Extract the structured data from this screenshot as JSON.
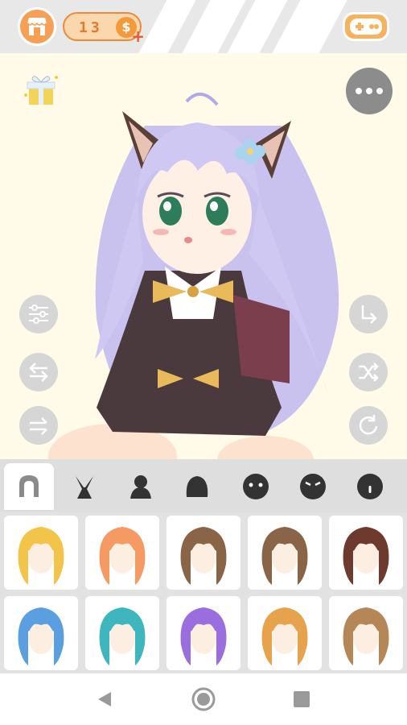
{
  "topbar": {
    "coins": "13",
    "coin_symbol": "$",
    "coin_plus": "+",
    "shop_icon": "shop-icon",
    "game_icon": "gamepad-icon"
  },
  "canvas": {
    "character": "anime-girl-character",
    "gift_icon": "gift-icon",
    "more_icon": "more-dots-icon",
    "left_tools": [
      "adjust-sliders-icon",
      "swap-arrows-icon",
      "flip-arrows-icon"
    ],
    "right_tools": [
      "export-icon",
      "shuffle-icon",
      "redo-icon"
    ]
  },
  "tabs": [
    {
      "name": "hair",
      "icon": "hair-icon",
      "active": true
    },
    {
      "name": "ears",
      "icon": "bunny-ears-icon",
      "active": false
    },
    {
      "name": "body",
      "icon": "body-silhouette-icon",
      "active": false
    },
    {
      "name": "head",
      "icon": "head-shape-icon",
      "active": false
    },
    {
      "name": "eyes",
      "icon": "eyes-face-icon",
      "active": false
    },
    {
      "name": "brows",
      "icon": "angry-face-icon",
      "active": false
    },
    {
      "name": "mouth",
      "icon": "mouth-face-icon",
      "active": false
    }
  ],
  "hair_items": [
    {
      "color": "#f3c44a"
    },
    {
      "color": "#f59a62"
    },
    {
      "color": "#8a6446"
    },
    {
      "color": "#8a6446"
    },
    {
      "color": "#6e3a2e"
    },
    {
      "color": "#5aa0e0"
    },
    {
      "color": "#3fb6bd"
    },
    {
      "color": "#9b6ee0"
    },
    {
      "color": "#e6a24c"
    },
    {
      "color": "#b58656"
    }
  ],
  "colors": {
    "accent_orange": "#f59a3b",
    "topbar_bg": "#e8e8e8",
    "canvas_bg": "#fffbe8",
    "hair_lavender": "#c9c2ee"
  }
}
